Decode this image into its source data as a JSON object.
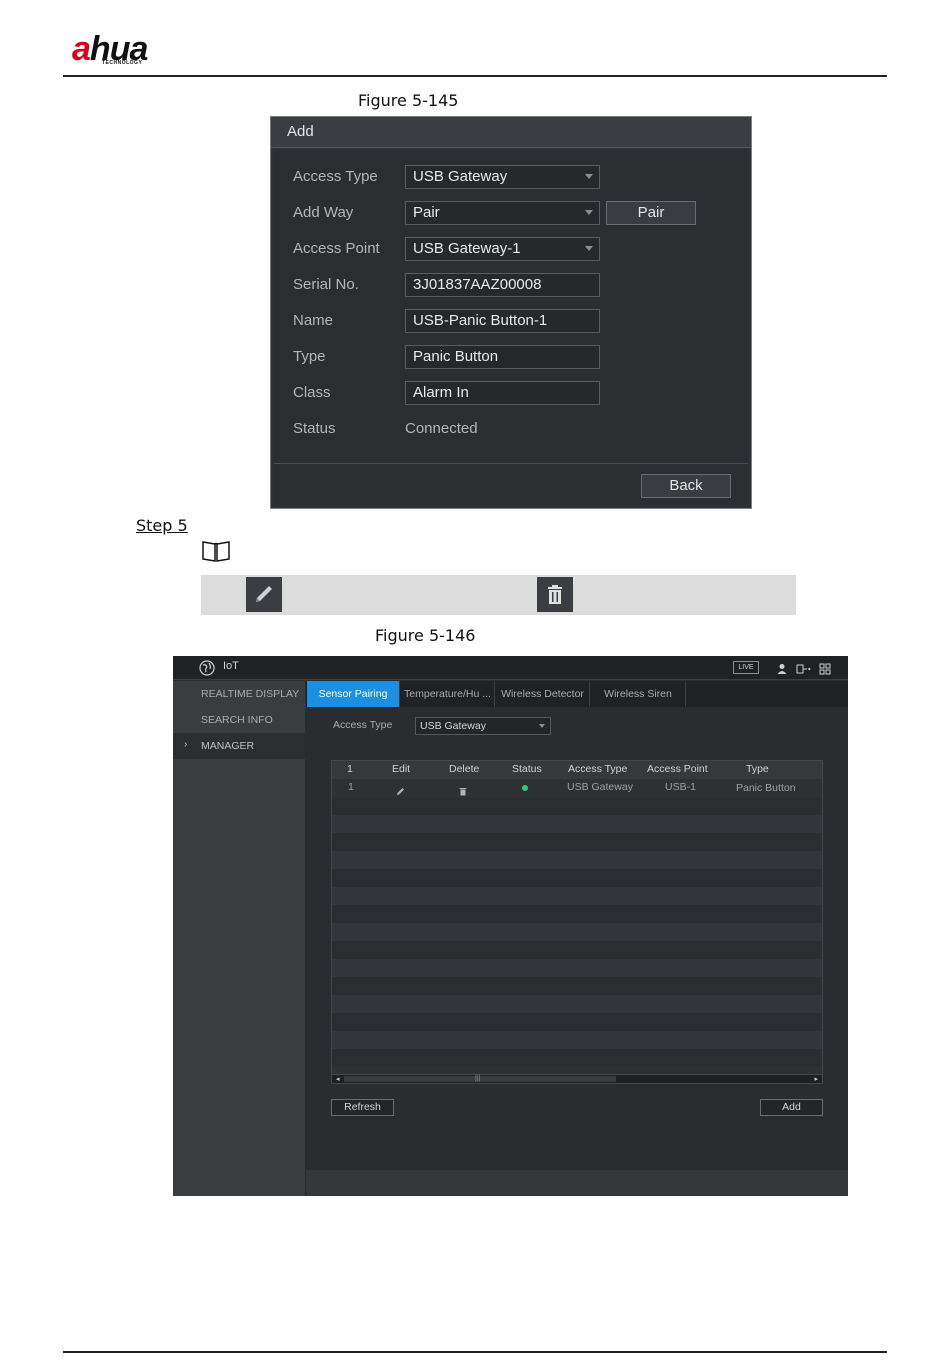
{
  "header": {
    "logo_main": "a",
    "logo_rest": "hua",
    "logo_sub": "TECHNOLOGY"
  },
  "figure1": {
    "caption": "Figure 5-145"
  },
  "add_dialog": {
    "title": "Add",
    "fields": [
      {
        "label": "Access Type",
        "value": "USB Gateway",
        "kind": "select"
      },
      {
        "label": "Add Way",
        "value": "Pair",
        "kind": "select"
      },
      {
        "label": "Access Point",
        "value": "USB Gateway-1",
        "kind": "select"
      },
      {
        "label": "Serial No.",
        "value": "3J01837AAZ00008",
        "kind": "input"
      },
      {
        "label": "Name",
        "value": "USB-Panic Button-1",
        "kind": "input"
      },
      {
        "label": "Type",
        "value": "Panic Button",
        "kind": "input"
      },
      {
        "label": "Class",
        "value": "Alarm In",
        "kind": "input"
      },
      {
        "label": "Status",
        "value": "Connected",
        "kind": "text"
      }
    ],
    "pair_button": "Pair",
    "back_button": "Back"
  },
  "step": {
    "label": "Step 5"
  },
  "note_icons": [
    "edit-icon",
    "delete-icon"
  ],
  "figure2": {
    "caption": "Figure 5-146"
  },
  "iot": {
    "title": "IoT",
    "live_badge": "LIVE",
    "sidebar": [
      "REALTIME DISPLAY",
      "SEARCH INFO",
      "MANAGER"
    ],
    "tabs": [
      "Sensor Pairing",
      "Temperature/Hu ...",
      "Wireless Detector",
      "Wireless Siren"
    ],
    "access_type_label": "Access Type",
    "access_type_value": "USB Gateway",
    "table": {
      "headers": [
        "1",
        "Edit",
        "Delete",
        "Status",
        "Access Type",
        "Access Point",
        "Type"
      ],
      "rows": [
        {
          "index": "1",
          "status_color": "#2ecc71",
          "access_type": "USB Gateway",
          "access_point": "USB-1",
          "type": "Panic Button"
        }
      ]
    },
    "refresh_button": "Refresh",
    "add_button": "Add"
  }
}
